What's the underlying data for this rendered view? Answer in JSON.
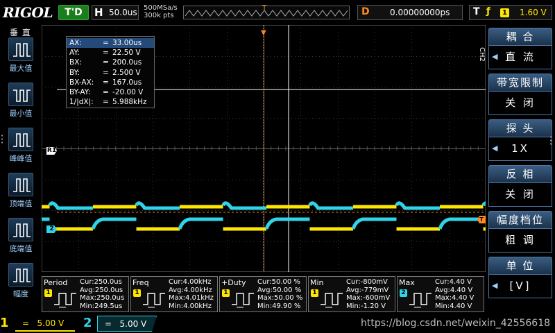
{
  "header": {
    "brand": "RIGOL",
    "trigger_status": "T'D",
    "timebase_label": "H",
    "timebase_value": "50.0us",
    "sample_rate": "500MSa/s",
    "memory_depth": "300k pts",
    "trigger_pos_marker": "T",
    "delay_label": "D",
    "delay_value": "0.00000000ps",
    "trigger_label": "T",
    "trigger_edge": "ƒ",
    "trigger_source": "1",
    "trigger_level": "1.60 V"
  },
  "left_menu": {
    "title": "垂 直",
    "items": [
      {
        "label": "最大值",
        "icon": "max-value-icon"
      },
      {
        "label": "最小值",
        "icon": "min-value-icon"
      },
      {
        "label": "峰峰值",
        "icon": "peak-to-peak-icon"
      },
      {
        "label": "顶端值",
        "icon": "top-value-icon"
      },
      {
        "label": "底端值",
        "icon": "base-value-icon"
      },
      {
        "label": "幅度",
        "icon": "amplitude-icon"
      }
    ]
  },
  "cursors": {
    "rows": [
      {
        "key": "AX:",
        "value": "33.00us",
        "highlight": true
      },
      {
        "key": "AY:",
        "value": "22.50 V"
      },
      {
        "key": "BX:",
        "value": "200.0us"
      },
      {
        "key": "BY:",
        "value": "2.500 V"
      },
      {
        "key": "BX-AX:",
        "value": "167.0us"
      },
      {
        "key": "BY-AY:",
        "value": "-20.00 V"
      },
      {
        "key": "1/|dX|:",
        "value": "5.988kHz"
      }
    ]
  },
  "markers": {
    "ref": "R1",
    "ch2": "2",
    "trig_level": "T"
  },
  "right_menu": {
    "channel_tab": "CH2",
    "items": [
      {
        "head": "耦 合",
        "value": "直 流",
        "has_arrow": true
      },
      {
        "head": "带宽限制",
        "value": "关 闭",
        "has_arrow": false
      },
      {
        "head": "探 头",
        "value": "1X",
        "has_arrow": true
      },
      {
        "head": "反 相",
        "value": "关 闭",
        "has_arrow": false
      },
      {
        "head": "幅度档位",
        "value": "粗 调",
        "has_arrow": false
      },
      {
        "head": "单 位",
        "value": "[V]",
        "has_arrow": true
      }
    ]
  },
  "measurements": [
    {
      "name": "Period",
      "source": "1",
      "src_color": "y",
      "cur": "Cur:250.0us",
      "avg": "Avg:250.0us",
      "max": "Max:250.0us",
      "min": "Min:249.5us"
    },
    {
      "name": "Freq",
      "source": "1",
      "src_color": "y",
      "cur": "Cur:4.00kHz",
      "avg": "Avg:4.00kHz",
      "max": "Max:4.01kHz",
      "min": "Min:4.00kHz"
    },
    {
      "name": "+Duty",
      "source": "1",
      "src_color": "y",
      "cur": "Cur:50.00 %",
      "avg": "Avg:50.00 %",
      "max": "Max:50.00 %",
      "min": "Min:49.90 %"
    },
    {
      "name": "Min",
      "source": "1",
      "src_color": "y",
      "cur": "Cur:-800mV",
      "avg": "Avg:-779mV",
      "max": "Max:-600mV",
      "min": "Min:-1.20 V"
    },
    {
      "name": "Max",
      "source": "2",
      "src_color": "c",
      "cur": "Cur:4.40 V",
      "avg": "Avg:4.40 V",
      "max": "Max:4.40 V",
      "min": "Min:4.40 V"
    }
  ],
  "channels": {
    "ch1_num": "1",
    "ch1_coupling": "=",
    "ch1_scale": "5.00 V",
    "ch2_num": "2",
    "ch2_coupling": "=",
    "ch2_scale": "5.00 V"
  },
  "watermark": "https://blog.csdn.net/weixin_42556618",
  "colors": {
    "ch1": "#ffe600",
    "ch2": "#2fd4e8",
    "trigger": "#ff8a1f",
    "menu": "#3a5d82"
  }
}
